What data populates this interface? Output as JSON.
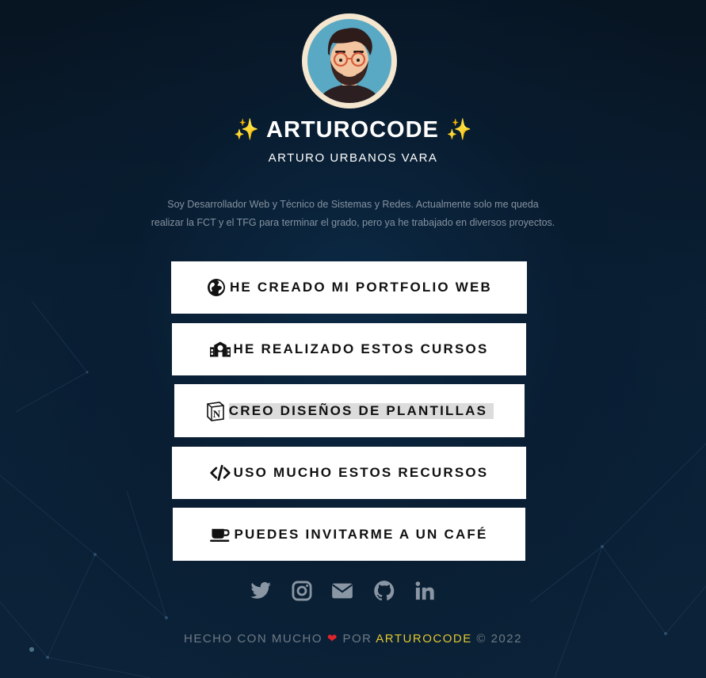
{
  "profile": {
    "title": "ARTUROCODE",
    "spark": "✨",
    "name": "ARTURO URBANOS VARA",
    "bio_line1": "Soy Desarrollador Web y Técnico de Sistemas y Redes. Actualmente solo me queda",
    "bio_line2": "realizar la FCT y el TFG para terminar el grado, pero ya he trabajado en diversos proyectos."
  },
  "links": [
    {
      "label": "HE CREADO MI PORTFOLIO WEB",
      "icon": "globe-icon"
    },
    {
      "label": "HE REALIZADO ESTOS CURSOS",
      "icon": "school-icon"
    },
    {
      "label": "CREO DISEÑOS DE PLANTILLAS",
      "icon": "notion-icon"
    },
    {
      "label": "USO MUCHO ESTOS RECURSOS",
      "icon": "code-icon"
    },
    {
      "label": "PUEDES INVITARME A UN CAFÉ",
      "icon": "coffee-icon"
    }
  ],
  "socials": [
    "twitter-icon",
    "instagram-icon",
    "envelope-icon",
    "github-icon",
    "linkedin-icon"
  ],
  "footer": {
    "prefix": "HECHO CON MUCHO",
    "middle": "POR",
    "brand": "ARTUROCODE",
    "suffix": "© 2022",
    "heart": "❤"
  },
  "colors": {
    "background": "#0a2035",
    "button_bg": "#ffffff",
    "brand_yellow": "#e3c730",
    "heart_red": "#e0242e",
    "muted_text": "#8592a0"
  }
}
